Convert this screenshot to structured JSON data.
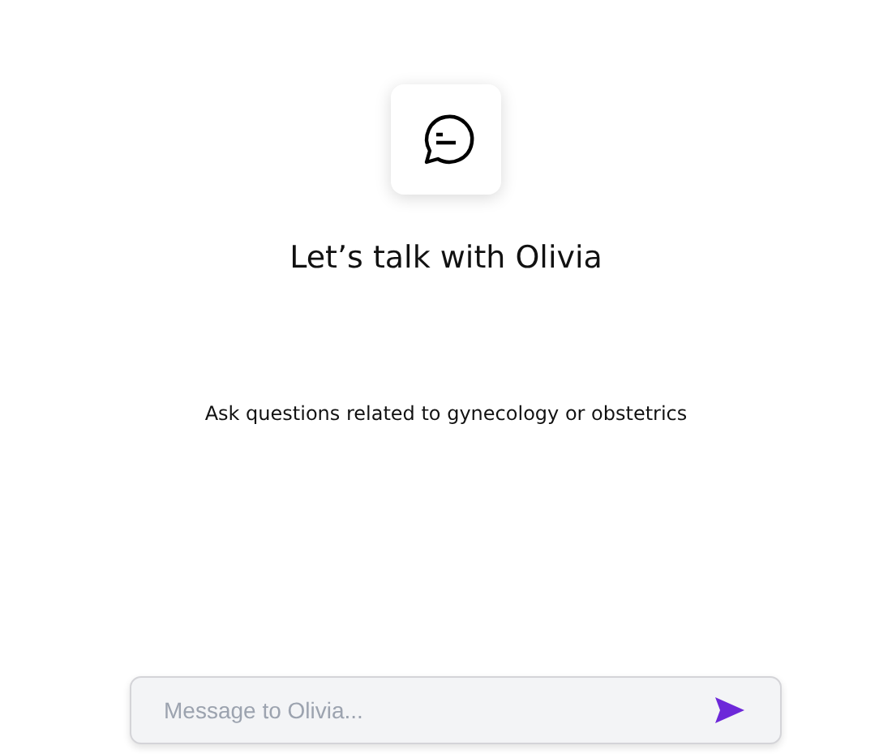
{
  "title": "Let’s talk with Olivia",
  "subtitle": "Ask questions related to gynecology or obstetrics",
  "composer": {
    "placeholder": "Message to Olivia..."
  }
}
